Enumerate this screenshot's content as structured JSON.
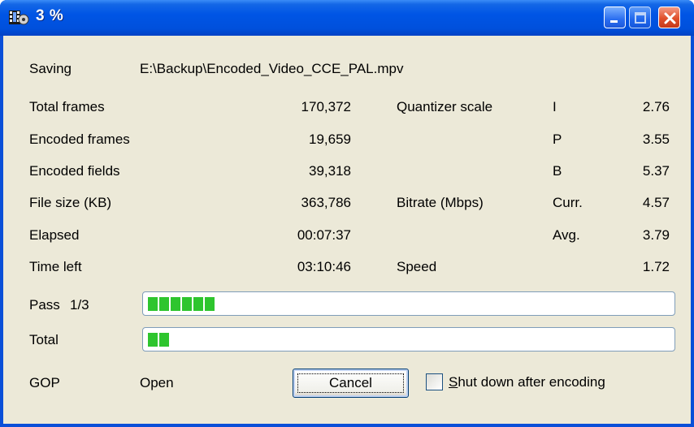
{
  "window": {
    "title": "3 %"
  },
  "saving": {
    "label": "Saving",
    "path": "E:\\Backup\\Encoded_Video_CCE_PAL.mpv"
  },
  "left_stats": [
    {
      "label": "Total frames",
      "value": "170,372"
    },
    {
      "label": "Encoded frames",
      "value": "19,659"
    },
    {
      "label": "Encoded fields",
      "value": "39,318"
    },
    {
      "label": "File size (KB)",
      "value": "363,786"
    },
    {
      "label": "Elapsed",
      "value": "00:07:37"
    },
    {
      "label": "Time left",
      "value": "03:10:46"
    }
  ],
  "quantizer": {
    "label": "Quantizer scale",
    "rows": [
      {
        "type": "I",
        "value": "2.76"
      },
      {
        "type": "P",
        "value": "3.55"
      },
      {
        "type": "B",
        "value": "5.37"
      }
    ]
  },
  "bitrate": {
    "label": "Bitrate (Mbps)",
    "rows": [
      {
        "type": "Curr.",
        "value": "4.57"
      },
      {
        "type": "Avg.",
        "value": "3.79"
      }
    ]
  },
  "speed": {
    "label": "Speed",
    "value": "1.72"
  },
  "pass": {
    "label": "Pass",
    "value": "1/3",
    "progress_fraction": 0.13
  },
  "total": {
    "label": "Total",
    "progress_fraction": 0.05
  },
  "gop": {
    "label": "GOP",
    "value": "Open"
  },
  "buttons": {
    "cancel": "Cancel"
  },
  "shutdown": {
    "label_accel": "S",
    "label_rest": "hut down after encoding",
    "checked": false
  }
}
